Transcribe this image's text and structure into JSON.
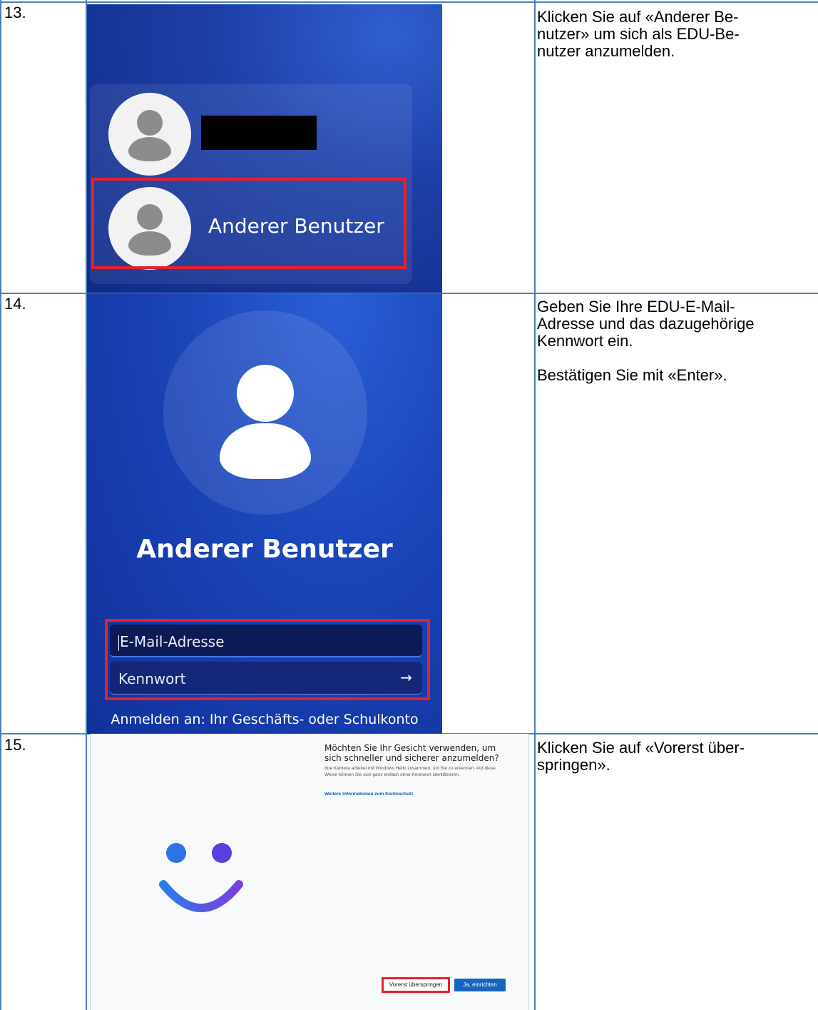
{
  "rows": [
    {
      "number": "13.",
      "instruction": [
        "Klicken Sie auf «Anderer Be-",
        "nutzer» um sich als EDU-Be-",
        "nutzer anzumelden."
      ],
      "screen": {
        "other_user_label": "Anderer Benutzer"
      }
    },
    {
      "number": "14.",
      "instruction_p1": [
        "Geben Sie Ihre EDU-E-Mail-",
        "Adresse und das dazugehörige",
        "Kennwort ein."
      ],
      "instruction_p2": "Bestätigen Sie mit «Enter».",
      "screen": {
        "title": "Anderer Benutzer",
        "email_placeholder": "E-Mail-Adresse",
        "password_placeholder": "Kennwort",
        "submit_icon": "arrow-right-icon",
        "sign_in_to": "Anmelden an: Ihr Geschäfts- oder Schulkonto"
      }
    },
    {
      "number": "15.",
      "instruction": [
        "Klicken Sie auf «Vorerst über-",
        "springen»."
      ],
      "screen": {
        "heading": "Möchten Sie Ihr Gesicht verwenden, um sich schneller und sicherer anzumelden?",
        "body": "Ihre Kamera arbeitet mit Windows Hello zusammen, um Sie zu erkennen. Auf diese Weise können Sie sich ganz einfach ohne Kennwort identifizieren.",
        "link": "Weitere Informationen zum Kontoschutz",
        "skip_button": "Vorerst überspringen",
        "setup_button": "Ja, einrichten"
      }
    }
  ],
  "colors": {
    "grid": "#4a7ebb",
    "highlight": "#e8202a",
    "windows_blue": "#1764c0"
  }
}
